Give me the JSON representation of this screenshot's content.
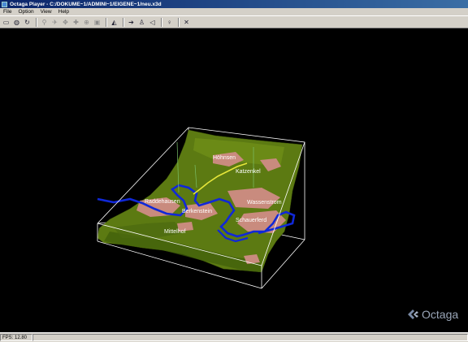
{
  "window": {
    "title": "Octaga Player - C:/DOKUME~1/ADMINI~1/EIGENE~1/neu.x3d"
  },
  "menu": {
    "file": "File",
    "option": "Option",
    "view": "View",
    "help": "Help"
  },
  "toolbar": {
    "icons": [
      "open-icon",
      "globe-icon",
      "refresh-icon",
      "walk-icon",
      "fly-icon",
      "examine-icon",
      "pan-icon",
      "zoom-icon",
      "fit-icon",
      "viewpoint-icon",
      "arrow-right-icon",
      "figure-icon",
      "speaker-icon",
      "light-icon",
      "collision-icon"
    ]
  },
  "scene": {
    "labels": {
      "hohnsen": "Höhnsen",
      "katzenkel": "Katzenkel",
      "kaltenhausen": "Raddehausen",
      "wasserstrom": "Wassenstrom",
      "borkenstein": "Berkenstein",
      "schauerferd": "Schauerferd",
      "mittelhof": "Mittelhof"
    },
    "colors": {
      "terrain": "#5c7a12",
      "terrain_dark": "#2f4a08",
      "settlement": "#c98b7e",
      "river": "#1028d8",
      "path": "#e6e63a",
      "box": "#ffffff"
    }
  },
  "logo": {
    "text": "Octaga"
  },
  "status": {
    "fps": "FPS: 12.80"
  }
}
